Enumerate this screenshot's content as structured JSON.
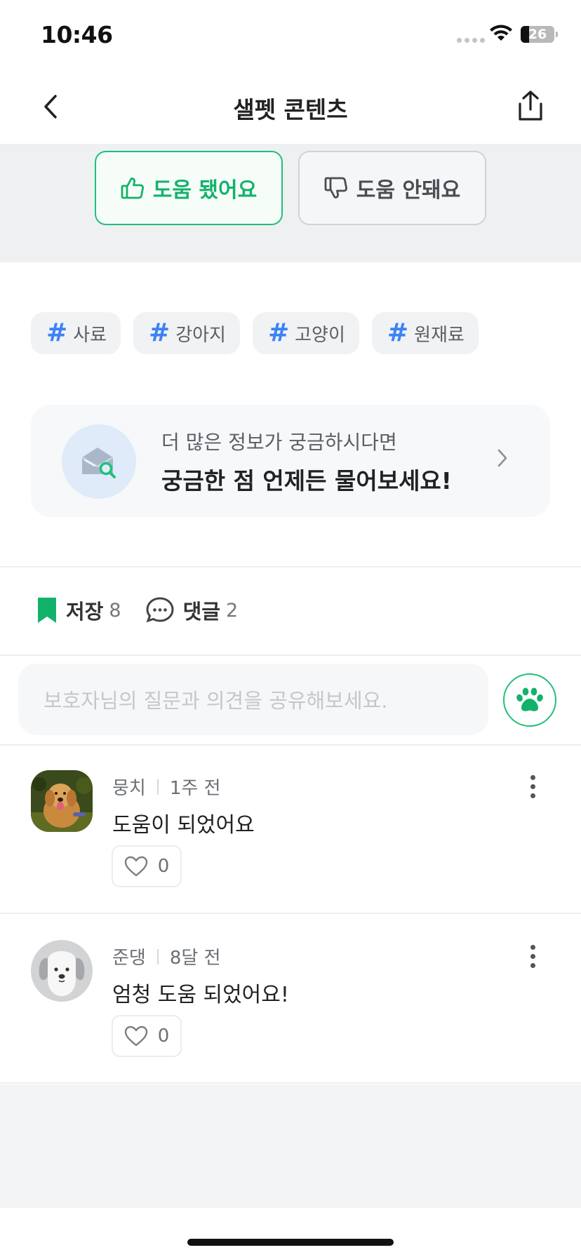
{
  "status_bar": {
    "time": "10:46",
    "battery": "26",
    "battery_level": 0.26
  },
  "nav": {
    "title": "샐펫 콘텐츠"
  },
  "feedback": {
    "helpful": "도움 됐어요",
    "not_helpful": "도움 안돼요"
  },
  "tags": [
    "사료",
    "강아지",
    "고양이",
    "원재료"
  ],
  "tag_symbol": "#",
  "cta": {
    "subtitle": "더 많은 정보가 궁금하시다면",
    "title": "궁금한 점 언제든 물어보세요!"
  },
  "actions": {
    "save_label": "저장",
    "save_count": "8",
    "comment_label": "댓글",
    "comment_count": "2"
  },
  "comment_input": {
    "placeholder": "보호자님의 질문과 의견을 공유해보세요."
  },
  "comments": [
    {
      "author": "뭉치",
      "time": "1주 전",
      "text": "도움이 되었어요",
      "likes": "0"
    },
    {
      "author": "준댕",
      "time": "8달 전",
      "text": "엄청 도움 되었어요!",
      "likes": "0"
    }
  ],
  "colors": {
    "accent": "#13b26b",
    "tag_hash": "#3b82f6"
  }
}
